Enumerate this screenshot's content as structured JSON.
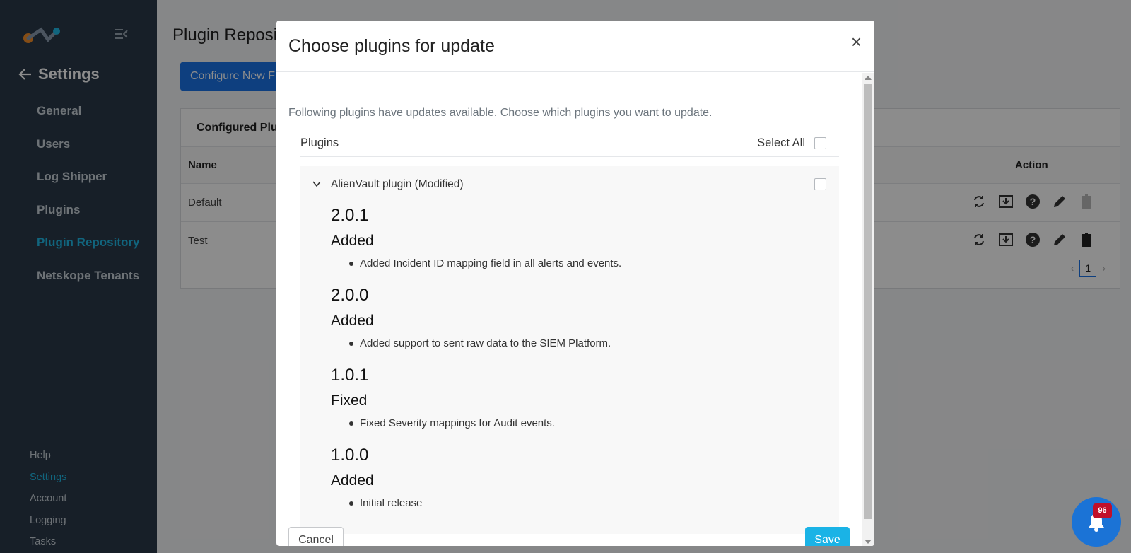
{
  "sidebar": {
    "title": "Settings",
    "nav": [
      {
        "label": "General"
      },
      {
        "label": "Users"
      },
      {
        "label": "Log Shipper"
      },
      {
        "label": "Plugins"
      },
      {
        "label": "Plugin Repository"
      },
      {
        "label": "Netskope Tenants"
      }
    ],
    "footer": [
      {
        "label": "Help"
      },
      {
        "label": "Settings"
      },
      {
        "label": "Account"
      },
      {
        "label": "Logging"
      },
      {
        "label": "Tasks"
      }
    ]
  },
  "main": {
    "page_title": "Plugin Reposi",
    "configure_button": "Configure New F",
    "card_title": "Configured Plu",
    "columns": {
      "name": "Name",
      "action": "Action"
    },
    "rows": [
      {
        "name": "Default"
      },
      {
        "name": "Test"
      }
    ],
    "current_page": "1"
  },
  "modal": {
    "title": "Choose plugins for update",
    "close_symbol": "×",
    "intro": "Following plugins have updates available. Choose which plugins you want to update.",
    "plugins_label": "Plugins",
    "select_all_label": "Select All",
    "plugin_name": "AlienVault plugin (Modified)",
    "changelog": [
      {
        "version": "2.0.1",
        "kind": "Added",
        "entry": "Added Incident ID mapping field in all alerts and events."
      },
      {
        "version": "2.0.0",
        "kind": "Added",
        "entry": "Added support to sent raw data to the SIEM Platform."
      },
      {
        "version": "1.0.1",
        "kind": "Fixed",
        "entry": "Fixed Severity mappings for Audit events."
      },
      {
        "version": "1.0.0",
        "kind": "Added",
        "entry": "Initial release"
      }
    ],
    "cancel_label": "Cancel",
    "save_label": "Save"
  },
  "notifications": {
    "count": "96"
  },
  "colors": {
    "accent": "#1fb8e6",
    "primary": "#1a73e8",
    "sidebar_bg": "#2b3a4a",
    "save": "#1ab3e6",
    "badge": "#c0102a"
  }
}
